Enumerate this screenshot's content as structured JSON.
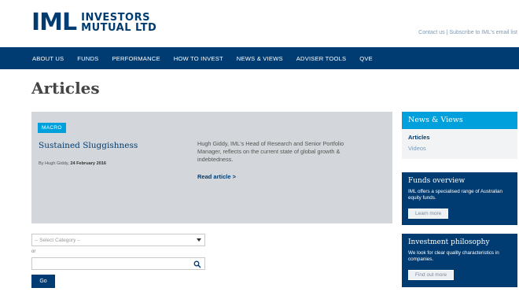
{
  "brand": {
    "mark": "IML",
    "line1": "INVESTORS",
    "line2": "MUTUAL LTD"
  },
  "header_links": {
    "contact": "Contact us",
    "separator": "|",
    "subscribe": "Subscribe to IML's email list"
  },
  "nav": {
    "items": [
      {
        "label": "ABOUT US"
      },
      {
        "label": "FUNDS"
      },
      {
        "label": "PERFORMANCE"
      },
      {
        "label": "HOW TO INVEST"
      },
      {
        "label": "NEWS & VIEWS"
      },
      {
        "label": "ADVISER TOOLS"
      },
      {
        "label": "QVE"
      }
    ]
  },
  "page": {
    "title": "Articles"
  },
  "feature": {
    "tag": "MACRO",
    "title": "Sustained Sluggishness",
    "byline_prefix": "By Hugh Giddy,",
    "byline_date": "24 February 2016",
    "summary": "Hugh Giddy, IML's Head of Research and Senior Portfolio Manager, reflects on the current state of global growth & indebtedness.",
    "read_more": "Read article >"
  },
  "filter": {
    "select_placeholder": "-- Select Category --",
    "or_label": "or",
    "search_value": "",
    "go_label": "Go"
  },
  "sidebar": {
    "news": {
      "title": "News & Views",
      "links": [
        {
          "label": "Articles",
          "active": true
        },
        {
          "label": "Videos",
          "active": false
        }
      ]
    },
    "funds": {
      "title": "Funds overview",
      "text": "IML offers a specialised range of Australian equity funds.",
      "button": "Learn more"
    },
    "philosophy": {
      "title": "Investment philosophy",
      "text": "We look for clear quality characteristics in companies.",
      "button": "Find out more"
    }
  },
  "colors": {
    "brand_navy": "#003c71",
    "accent_blue": "#00a0dc",
    "feature_bg": "#d3d6da",
    "link_muted": "#7a9ab8"
  },
  "icons": {
    "search": "search-icon",
    "dropdown": "chevron-down-icon"
  }
}
